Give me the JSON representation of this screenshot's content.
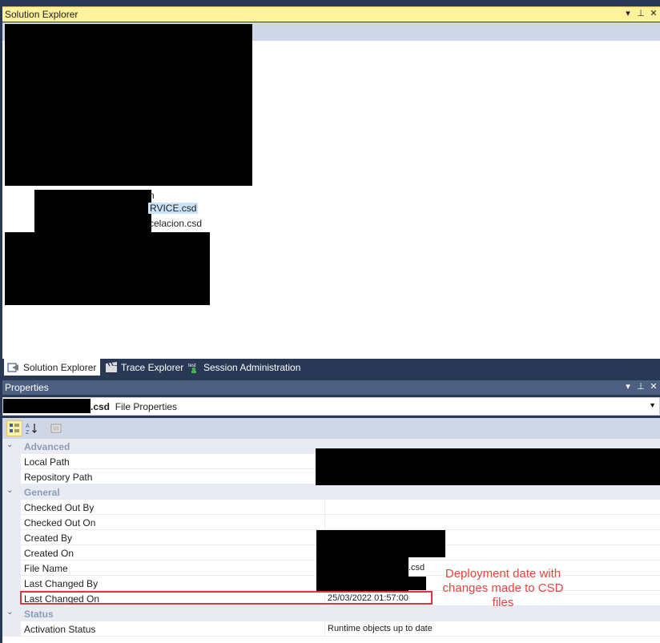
{
  "solution_explorer": {
    "title": "Solution Explorer",
    "title_buttons": [
      "▾",
      "⊥",
      "✕"
    ],
    "tree_items": {
      "item_1": "n",
      "item_2": "RVICE.csd",
      "item_3": "celacion.csd"
    }
  },
  "bottom_tabs": [
    {
      "label": "Solution Explorer",
      "icon": "solution-explorer-icon",
      "active": true
    },
    {
      "label": "Trace Explorer",
      "icon": "clapperboard-icon",
      "active": false
    },
    {
      "label": "Session Administration",
      "icon": "session-admin-icon",
      "active": false
    }
  ],
  "properties": {
    "title": "Properties",
    "combo": {
      "name_suffix": ".csd",
      "label": "File Properties"
    },
    "categories": [
      {
        "name": "Advanced",
        "rows": [
          {
            "name": "Local Path",
            "value": ""
          },
          {
            "name": "Repository Path",
            "value": ""
          }
        ]
      },
      {
        "name": "General",
        "rows": [
          {
            "name": "Checked Out By",
            "value": ""
          },
          {
            "name": "Checked Out On",
            "value": ""
          },
          {
            "name": "Created By",
            "value": ""
          },
          {
            "name": "Created On",
            "value": ""
          },
          {
            "name": "File Name",
            "value": ".csd"
          },
          {
            "name": "Last Changed By",
            "value": ""
          },
          {
            "name": "Last Changed On",
            "value": "25/03/2022 01:57:00"
          }
        ]
      },
      {
        "name": "Status",
        "rows": [
          {
            "name": "Activation Status",
            "value": "Runtime objects up to date"
          }
        ]
      }
    ]
  },
  "annotation": {
    "text": "Deployment date with changes made to CSD files",
    "color": "#e8453f"
  },
  "colors": {
    "accent_title": "#fff29d",
    "frame": "#293955",
    "inactive_title": "#4d6082"
  }
}
